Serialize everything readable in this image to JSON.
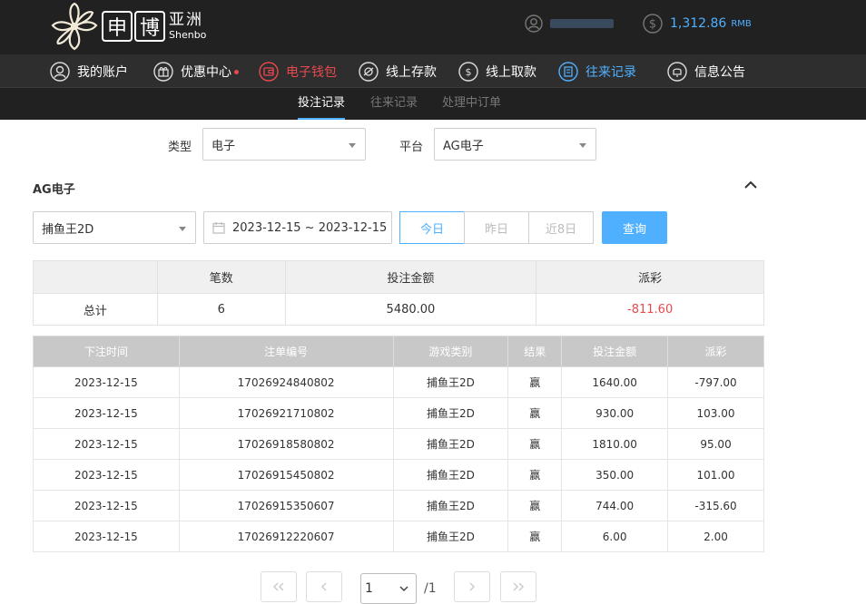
{
  "header": {
    "logo_text_cn": "亚洲",
    "logo_text_en": "Shenbo",
    "logo_box_1": "申",
    "logo_box_2": "博",
    "balance": "1,312.86",
    "balance_unit": "RMB"
  },
  "nav": {
    "items": [
      {
        "label": "我的账户",
        "icon": "user-circle-icon"
      },
      {
        "label": "优惠中心",
        "icon": "gift-icon"
      },
      {
        "label": "电子钱包",
        "icon": "wallet-icon"
      },
      {
        "label": "线上存款",
        "icon": "deposit-icon"
      },
      {
        "label": "线上取款",
        "icon": "withdraw-icon"
      },
      {
        "label": "往来记录",
        "icon": "records-icon"
      },
      {
        "label": "信息公告",
        "icon": "bell-icon"
      }
    ],
    "active_red": "电子钱包",
    "active_blue": "往来记录",
    "accent_red": "#e8494f",
    "accent_blue": "#4fb0ff"
  },
  "subnav": {
    "tabs": [
      "投注记录",
      "往来记录",
      "处理中订单"
    ],
    "active": "投注记录"
  },
  "filters": {
    "type_label": "类型",
    "type_value": "电子",
    "platform_label": "平台",
    "platform_value": "AG电子"
  },
  "section": {
    "title": "AG电子",
    "game_select": "捕鱼王2D",
    "date_range": "2023-12-15 ~ 2023-12-15",
    "range_buttons": [
      "今日",
      "昨日",
      "近8日"
    ],
    "active_range": "今日",
    "query_label": "查询"
  },
  "summary": {
    "headers": [
      "",
      "笔数",
      "投注金额",
      "派彩"
    ],
    "row_label": "总计",
    "count": "6",
    "bet_total": "5480.00",
    "payout_total": "-811.60"
  },
  "detail": {
    "headers": [
      "下注时间",
      "注单编号",
      "游戏类别",
      "结果",
      "投注金额",
      "派彩"
    ],
    "rows": [
      {
        "time": "2023-12-15",
        "id": "17026924840802",
        "game": "捕鱼王2D",
        "result": "赢",
        "bet": "1640.00",
        "payout": "-797.00"
      },
      {
        "time": "2023-12-15",
        "id": "17026921710802",
        "game": "捕鱼王2D",
        "result": "赢",
        "bet": "930.00",
        "payout": "103.00"
      },
      {
        "time": "2023-12-15",
        "id": "17026918580802",
        "game": "捕鱼王2D",
        "result": "赢",
        "bet": "1810.00",
        "payout": "95.00"
      },
      {
        "time": "2023-12-15",
        "id": "17026915450802",
        "game": "捕鱼王2D",
        "result": "赢",
        "bet": "350.00",
        "payout": "101.00"
      },
      {
        "time": "2023-12-15",
        "id": "17026915350607",
        "game": "捕鱼王2D",
        "result": "赢",
        "bet": "744.00",
        "payout": "-315.60"
      },
      {
        "time": "2023-12-15",
        "id": "17026912220607",
        "game": "捕鱼王2D",
        "result": "赢",
        "bet": "6.00",
        "payout": "2.00"
      }
    ]
  },
  "pagination": {
    "current": "1",
    "total": "/1"
  }
}
